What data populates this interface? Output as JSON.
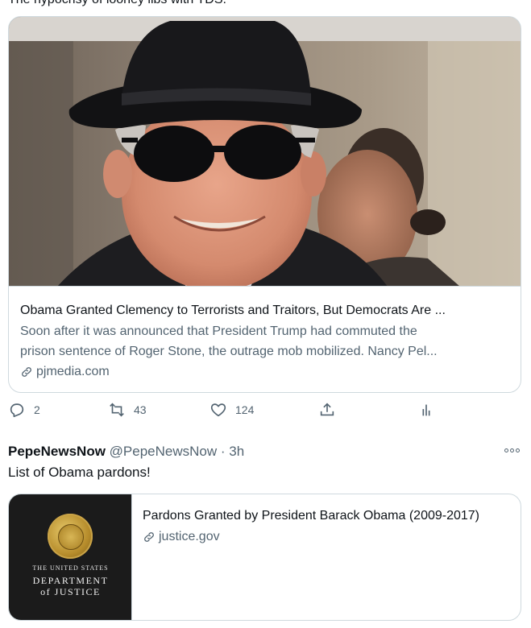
{
  "tweet1": {
    "text_partial": "The hypocrisy of looney libs with TDS.",
    "card": {
      "title": "Obama Granted Clemency to Terrorists and Traitors, But Democrats Are ...",
      "desc_line1": "Soon after it was announced that President Trump had commuted the",
      "desc_line2": "prison sentence of Roger Stone, the outrage mob mobilized. Nancy Pel...",
      "domain": "pjmedia.com"
    },
    "actions": {
      "reply_count": "2",
      "retweet_count": "43",
      "like_count": "124"
    }
  },
  "tweet2": {
    "name": "PepeNewsNow",
    "handle": "@PepeNewsNow",
    "separator": "·",
    "time": "3h",
    "text": "List of Obama pardons!",
    "card": {
      "image_line1": "THE UNITED STATES",
      "image_line2": "DEPARTMENT",
      "image_line3": "of JUSTICE",
      "title": "Pardons Granted by President Barack Obama (2009-2017)",
      "domain": "justice.gov"
    }
  },
  "colors": {
    "text": "#0f1419",
    "secondary": "#536471",
    "border": "#cfd9de"
  }
}
